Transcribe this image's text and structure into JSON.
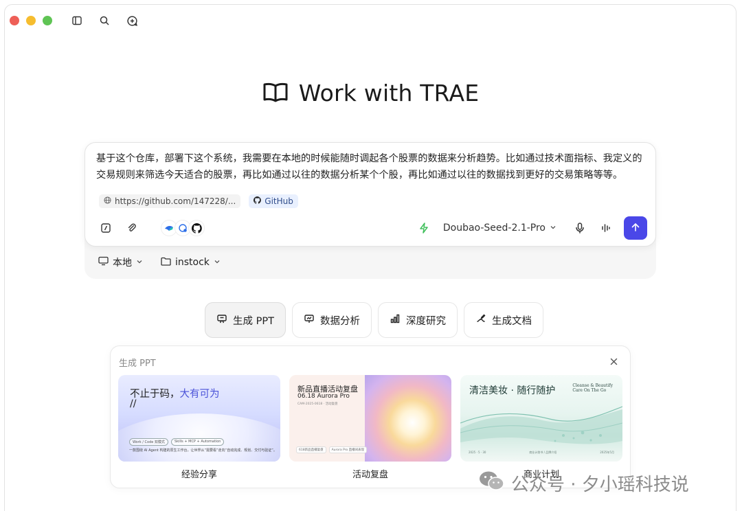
{
  "hero": {
    "title": "Work with TRAE"
  },
  "composer": {
    "prompt": "基于这个仓库，部署下这个系统，我需要在本地的时候能随时调起各个股票的数据来分析趋势。比如通过技术面指标、我定义的交易规则来筛选今天适合的股票，再比如通过以往的数据分析某个个股，再比如通过以往的数据找到更好的交易策略等等。",
    "link_chip": "https://github.com/147228/...",
    "github_chip": "GitHub",
    "model": "Doubao-Seed-2.1-Pro"
  },
  "env": {
    "location": "本地",
    "project": "instock"
  },
  "modes": [
    {
      "label": "生成 PPT"
    },
    {
      "label": "数据分析"
    },
    {
      "label": "深度研究"
    },
    {
      "label": "生成文档"
    }
  ],
  "panel": {
    "title": "生成 PPT",
    "cards": [
      {
        "label": "经验分享",
        "headline": "不止于码，",
        "highlight": "大有可为",
        "sub": "//",
        "tags": [
          "Work / Code 双模式",
          "Skills + MCP + Automation"
        ],
        "small": "一款围绕 AI Agent 构建的原生工作台，让世界从“需要看”走向“自动完成、规划、交付与验证”。"
      },
      {
        "label": "活动复盘",
        "headline": "新品直播活动复盘",
        "sub": "06.18 Aurora Pro",
        "meta": "CAM-2025-0618 · 活动复盘",
        "foot": [
          "618新品直播复盘",
          "Aurora Pro 直播间表现"
        ]
      },
      {
        "label": "商业计划",
        "headline": "清洁美妆 · 随行随护",
        "sub_en_1": "Cleanse & Beautify",
        "sub_en_2": "Care On The Go",
        "foot": [
          "2025 · 5 · 30",
          "商业计划书 / 品牌介绍",
          "2025年5月"
        ]
      }
    ]
  },
  "watermark": {
    "text": "公众号 · 夕小瑶科技说"
  },
  "colors": {
    "accent": "#4a47e8",
    "bolt": "#3fbf5a"
  }
}
